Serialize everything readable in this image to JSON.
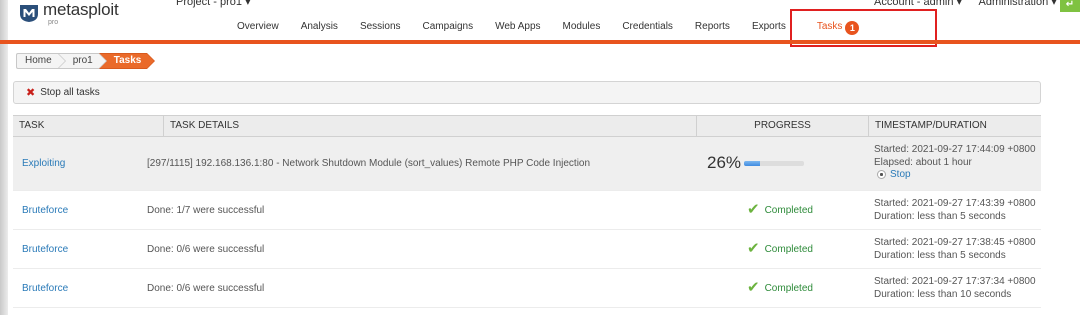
{
  "header": {
    "logo_text": "metasploit",
    "logo_sub": "pro",
    "project": "Project - pro1 ▾",
    "account": "Account - admin ▾",
    "administration": "Administration ▾",
    "help": "?",
    "green_button": "↵"
  },
  "nav": {
    "items": [
      "Overview",
      "Analysis",
      "Sessions",
      "Campaigns",
      "Web Apps",
      "Modules",
      "Credentials",
      "Reports",
      "Exports"
    ],
    "tasks_label": "Tasks",
    "tasks_badge": "1"
  },
  "breadcrumb": [
    "Home",
    "pro1",
    "Tasks"
  ],
  "toolbar": {
    "stop_all": "Stop all tasks"
  },
  "table": {
    "headers": [
      "TASK",
      "TASK DETAILS",
      "PROGRESS",
      "TIMESTAMP/DURATION"
    ],
    "rows": [
      {
        "task": "Exploiting",
        "details": "[297/1115] 192.168.136.1:80 - Network Shutdown Module (sort_values) Remote PHP Code Injection",
        "progress": "26%",
        "progress_fraction": 0.26,
        "ts_line1": "Started: 2021-09-27 17:44:09 +0800",
        "ts_line2": "Elapsed: about 1 hour",
        "stop": "Stop"
      },
      {
        "task": "Bruteforce",
        "details": "Done: 1/7 were successful",
        "status": "Completed",
        "ts_line1": "Started: 2021-09-27 17:43:39 +0800",
        "ts_line2": "Duration: less than 5 seconds"
      },
      {
        "task": "Bruteforce",
        "details": "Done: 0/6 were successful",
        "status": "Completed",
        "ts_line1": "Started: 2021-09-27 17:38:45 +0800",
        "ts_line2": "Duration: less than 5 seconds"
      },
      {
        "task": "Bruteforce",
        "details": "Done: 0/6 were successful",
        "status": "Completed",
        "ts_line1": "Started: 2021-09-27 17:37:34 +0800",
        "ts_line2": "Duration: less than 10 seconds"
      }
    ]
  },
  "colors": {
    "accent": "#e8541e",
    "link": "#2a7ab8",
    "success": "#2e8b3a",
    "highlight": "#e02020"
  }
}
